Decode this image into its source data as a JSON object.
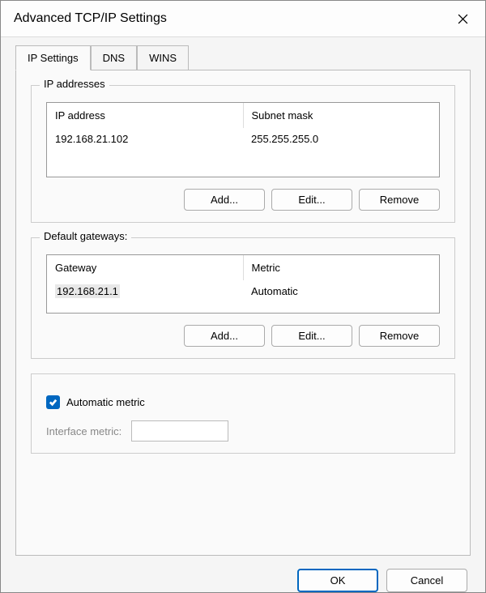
{
  "window": {
    "title": "Advanced TCP/IP Settings"
  },
  "tabs": [
    {
      "label": "IP Settings",
      "active": true
    },
    {
      "label": "DNS",
      "active": false
    },
    {
      "label": "WINS",
      "active": false
    }
  ],
  "ip_section": {
    "legend": "IP addresses",
    "headers": [
      "IP address",
      "Subnet mask"
    ],
    "rows": [
      {
        "ip": "192.168.21.102",
        "mask": "255.255.255.0"
      }
    ],
    "buttons": {
      "add": "Add...",
      "edit": "Edit...",
      "remove": "Remove"
    }
  },
  "gw_section": {
    "legend": "Default gateways:",
    "headers": [
      "Gateway",
      "Metric"
    ],
    "rows": [
      {
        "gateway": "192.168.21.1",
        "metric": "Automatic",
        "selected": true
      }
    ],
    "buttons": {
      "add": "Add...",
      "edit": "Edit...",
      "remove": "Remove"
    }
  },
  "auto_metric": {
    "label": "Automatic metric",
    "checked": true,
    "interface_label": "Interface metric:",
    "interface_value": ""
  },
  "dialog_buttons": {
    "ok": "OK",
    "cancel": "Cancel"
  }
}
